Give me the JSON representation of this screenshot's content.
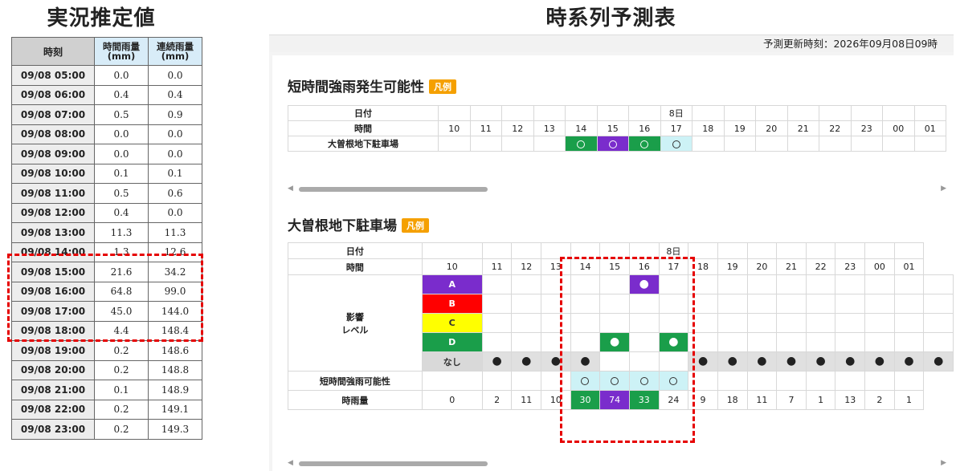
{
  "left": {
    "title": "実況推定値",
    "headers": [
      "時刻",
      "時間雨量\n(mm)",
      "連続雨量\n(mm)"
    ],
    "rows": [
      [
        "09/08 05:00",
        "0.0",
        "0.0"
      ],
      [
        "09/08 06:00",
        "0.4",
        "0.4"
      ],
      [
        "09/08 07:00",
        "0.5",
        "0.9"
      ],
      [
        "09/08 08:00",
        "0.0",
        "0.0"
      ],
      [
        "09/08 09:00",
        "0.0",
        "0.0"
      ],
      [
        "09/08 10:00",
        "0.1",
        "0.1"
      ],
      [
        "09/08 11:00",
        "0.5",
        "0.6"
      ],
      [
        "09/08 12:00",
        "0.4",
        "0.0"
      ],
      [
        "09/08 13:00",
        "11.3",
        "11.3"
      ],
      [
        "09/08 14:00",
        "1.3",
        "12.6"
      ],
      [
        "09/08 15:00",
        "21.6",
        "34.2"
      ],
      [
        "09/08 16:00",
        "64.8",
        "99.0"
      ],
      [
        "09/08 17:00",
        "45.0",
        "144.0"
      ],
      [
        "09/08 18:00",
        "4.4",
        "148.4"
      ],
      [
        "09/08 19:00",
        "0.2",
        "148.6"
      ],
      [
        "09/08 20:00",
        "0.2",
        "148.8"
      ],
      [
        "09/08 21:00",
        "0.1",
        "148.9"
      ],
      [
        "09/08 22:00",
        "0.2",
        "149.1"
      ],
      [
        "09/08 23:00",
        "0.2",
        "149.3"
      ]
    ]
  },
  "right": {
    "title": "時系列予測表",
    "update_time": "予測更新時刻：2026年09月08日09時",
    "legend_label": "凡例",
    "hours": [
      "10",
      "11",
      "12",
      "13",
      "14",
      "15",
      "16",
      "17",
      "18",
      "19",
      "20",
      "21",
      "22",
      "23",
      "00",
      "01"
    ],
    "date_label": "日付",
    "date_value": "8日",
    "hour_label": "時間",
    "section1": {
      "title": "短時間強雨発生可能性",
      "row_label": "大曽根地下駐車場",
      "cells": [
        "",
        "",
        "",
        "",
        "g",
        "p",
        "g",
        "c",
        "",
        "",
        "",
        "",
        "",
        "",
        "",
        ""
      ]
    },
    "section2": {
      "title": "大曽根地下駐車場",
      "influence_label": "影響\nレベル",
      "levels": [
        {
          "name": "A",
          "color": "#7a2ccc",
          "cells": [
            "",
            "",
            "",
            "",
            "",
            "p",
            "",
            "",
            "",
            "",
            "",
            "",
            "",
            "",
            "",
            ""
          ]
        },
        {
          "name": "B",
          "color": "#ff0000",
          "cells": [
            "",
            "",
            "",
            "",
            "",
            "",
            "",
            "",
            "",
            "",
            "",
            "",
            "",
            "",
            "",
            ""
          ]
        },
        {
          "name": "C",
          "color": "#ffff00",
          "cells": [
            "",
            "",
            "",
            "",
            "",
            "",
            "",
            "",
            "",
            "",
            "",
            "",
            "",
            "",
            "",
            ""
          ]
        },
        {
          "name": "D",
          "color": "#1a9e4a",
          "cells": [
            "",
            "",
            "",
            "",
            "g",
            "",
            "g",
            "",
            "",
            "",
            "",
            "",
            "",
            "",
            "",
            ""
          ]
        },
        {
          "name": "なし",
          "color": "#d9d9d9",
          "cells": [
            "n",
            "n",
            "n",
            "n",
            "",
            "",
            "",
            "n",
            "n",
            "n",
            "n",
            "n",
            "n",
            "n",
            "n",
            "n"
          ]
        }
      ],
      "possibility_label": "短時間強雨可能性",
      "possibility_cells": [
        "",
        "",
        "",
        "",
        "c",
        "c",
        "c",
        "c",
        "",
        "",
        "",
        "",
        "",
        "",
        "",
        ""
      ],
      "rain_label": "時雨量",
      "rain_values": [
        "0",
        "2",
        "11",
        "10",
        "30",
        "74",
        "33",
        "24",
        "9",
        "18",
        "11",
        "7",
        "1",
        "13",
        "2",
        "1"
      ],
      "rain_colors": [
        "",
        "",
        "",
        "",
        "g",
        "p",
        "g",
        "",
        "",
        "",
        "",
        "",
        "",
        "",
        "",
        ""
      ]
    }
  }
}
